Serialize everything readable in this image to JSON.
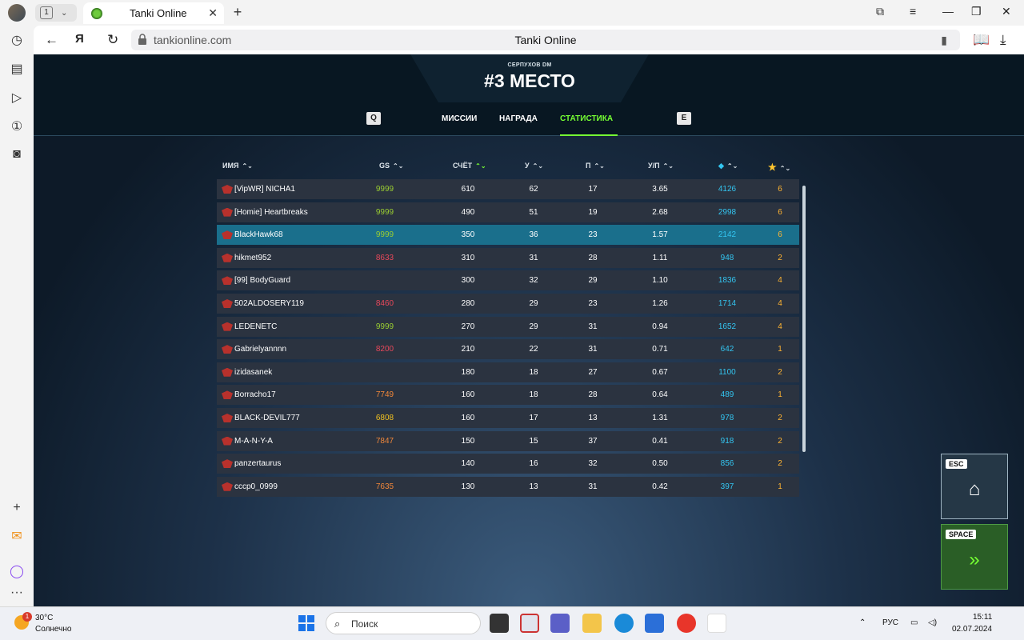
{
  "browser": {
    "tab_count": "1",
    "tab_title": "Tanki Online",
    "url_host": "tankionline.com",
    "page_title": "Tanki Online"
  },
  "game": {
    "mode": "СЕРПУХОВ DM",
    "place": "#3 МЕСТО",
    "key_left": "Q",
    "key_right": "E",
    "tabs": [
      {
        "label": "МИССИИ",
        "active": false
      },
      {
        "label": "НАГРАДА",
        "active": false
      },
      {
        "label": "СТАТИСТИКА",
        "active": true
      }
    ],
    "columns": {
      "name": "ИМЯ",
      "gs": "GS",
      "score": "СЧЁТ",
      "kills": "У",
      "deaths": "П",
      "kd": "У/П"
    },
    "players": [
      {
        "name": "[VipWR] NICHA1",
        "gs": "9999",
        "gs_color": "#9acd32",
        "score": "610",
        "kills": "62",
        "deaths": "17",
        "kd": "3.65",
        "crystals": "4126",
        "stars": "6",
        "me": false
      },
      {
        "name": "[Homie] Heartbreaks",
        "gs": "9999",
        "gs_color": "#9acd32",
        "score": "490",
        "kills": "51",
        "deaths": "19",
        "kd": "2.68",
        "crystals": "2998",
        "stars": "6",
        "me": false
      },
      {
        "name": "BlackHawk68",
        "gs": "9999",
        "gs_color": "#9acd32",
        "score": "350",
        "kills": "36",
        "deaths": "23",
        "kd": "1.57",
        "crystals": "2142",
        "stars": "6",
        "me": true
      },
      {
        "name": "hikmet952",
        "gs": "8633",
        "gs_color": "#e8485a",
        "score": "310",
        "kills": "31",
        "deaths": "28",
        "kd": "1.11",
        "crystals": "948",
        "stars": "2",
        "me": false
      },
      {
        "name": "[99] BodyGuard",
        "gs": "",
        "gs_color": "#e8485a",
        "score": "300",
        "kills": "32",
        "deaths": "29",
        "kd": "1.10",
        "crystals": "1836",
        "stars": "4",
        "me": false
      },
      {
        "name": "502ALDOSERY119",
        "gs": "8460",
        "gs_color": "#e8485a",
        "score": "280",
        "kills": "29",
        "deaths": "23",
        "kd": "1.26",
        "crystals": "1714",
        "stars": "4",
        "me": false
      },
      {
        "name": "LEDENETC",
        "gs": "9999",
        "gs_color": "#9acd32",
        "score": "270",
        "kills": "29",
        "deaths": "31",
        "kd": "0.94",
        "crystals": "1652",
        "stars": "4",
        "me": false
      },
      {
        "name": "Gabrielyannnn",
        "gs": "8200",
        "gs_color": "#e8485a",
        "score": "210",
        "kills": "22",
        "deaths": "31",
        "kd": "0.71",
        "crystals": "642",
        "stars": "1",
        "me": false
      },
      {
        "name": "izidasanek",
        "gs": "",
        "gs_color": "#e8485a",
        "score": "180",
        "kills": "18",
        "deaths": "27",
        "kd": "0.67",
        "crystals": "1100",
        "stars": "2",
        "me": false
      },
      {
        "name": "Borracho17",
        "gs": "7749",
        "gs_color": "#f0873a",
        "score": "160",
        "kills": "18",
        "deaths": "28",
        "kd": "0.64",
        "crystals": "489",
        "stars": "1",
        "me": false
      },
      {
        "name": "BLACK-DEVIL777",
        "gs": "6808",
        "gs_color": "#f0c020",
        "score": "160",
        "kills": "17",
        "deaths": "13",
        "kd": "1.31",
        "crystals": "978",
        "stars": "2",
        "me": false
      },
      {
        "name": "M-A-N-Y-A",
        "gs": "7847",
        "gs_color": "#f0873a",
        "score": "150",
        "kills": "15",
        "deaths": "37",
        "kd": "0.41",
        "crystals": "918",
        "stars": "2",
        "me": false
      },
      {
        "name": "panzertaurus",
        "gs": "",
        "gs_color": "#e8485a",
        "score": "140",
        "kills": "16",
        "deaths": "32",
        "kd": "0.50",
        "crystals": "856",
        "stars": "2",
        "me": false
      },
      {
        "name": "cccp0_0999",
        "gs": "7635",
        "gs_color": "#f0873a",
        "score": "130",
        "kills": "13",
        "deaths": "31",
        "kd": "0.42",
        "crystals": "397",
        "stars": "1",
        "me": false
      }
    ],
    "esc_key": "ESC",
    "space_key": "SPACE"
  },
  "taskbar": {
    "weather_badge": "1",
    "temperature": "30°C",
    "condition": "Солнечно",
    "search_placeholder": "Поиск",
    "language": "РУС",
    "time": "15:11",
    "date": "02.07.2024"
  }
}
